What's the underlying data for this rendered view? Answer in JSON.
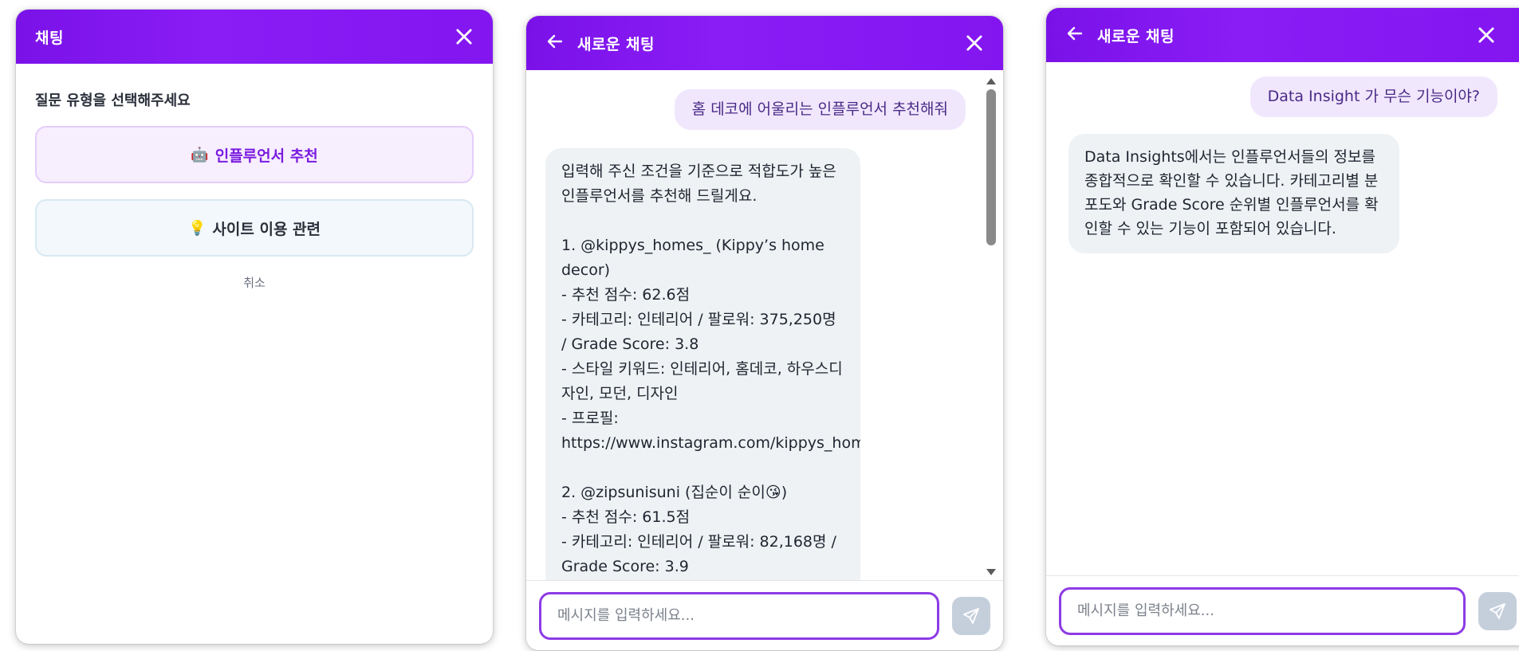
{
  "panel1": {
    "header": {
      "title": "채팅"
    },
    "prompt": "질문 유형을 선택해주세요",
    "options": [
      {
        "emoji": "🤖",
        "label": "인플루언서 추천"
      },
      {
        "emoji": "💡",
        "label": "사이트 이용 관련"
      }
    ],
    "cancel_label": "취소"
  },
  "panel2": {
    "header": {
      "title": "새로운 채팅"
    },
    "user_message": "홈 데코에 어울리는 인플루언서 추천해줘",
    "bot_message": "입력해 주신 조건을 기준으로 적합도가 높은 인플루언서를 추천해 드릴게요.\n\n1. @kippys_homes_ (Kippy’s home decor)\n- 추천 점수: 62.6점\n- 카테고리: 인테리어 / 팔로워: 375,250명 / Grade Score: 3.8\n- 스타일 키워드: 인테리어, 홈데코, 하우스디자인, 모던, 디자인\n- 프로필: https://www.instagram.com/kippys_homes_/\n\n2. @zipsunisuni (집순이 순이😘)\n- 추천 점수: 61.5점\n- 카테고리: 인테리어 / 팔로워: 82,168명 / Grade Score: 3.9",
    "input_placeholder": "메시지를 입력하세요..."
  },
  "panel3": {
    "header": {
      "title": "새로운 채팅"
    },
    "user_message": "Data Insight 가 무슨 기능이야?",
    "bot_message": "Data Insights에서는 인플루언서들의 정보를 종합적으로 확인할 수 있습니다. 카테고리별 분포도와 Grade Score 순위별 인플루언서를 확인할 수 있는 기능이 포함되어 있습니다.",
    "input_placeholder": "메시지를 입력하세요..."
  },
  "colors": {
    "header_purple": "#8316f0",
    "input_border": "#8d3be6",
    "user_bubble": "#f1e7fd",
    "bot_bubble": "#eef2f4",
    "send_button": "#c5cfdc"
  },
  "icons": [
    "close-icon",
    "back-arrow-icon",
    "send-icon",
    "robot-emoji",
    "lightbulb-emoji"
  ]
}
